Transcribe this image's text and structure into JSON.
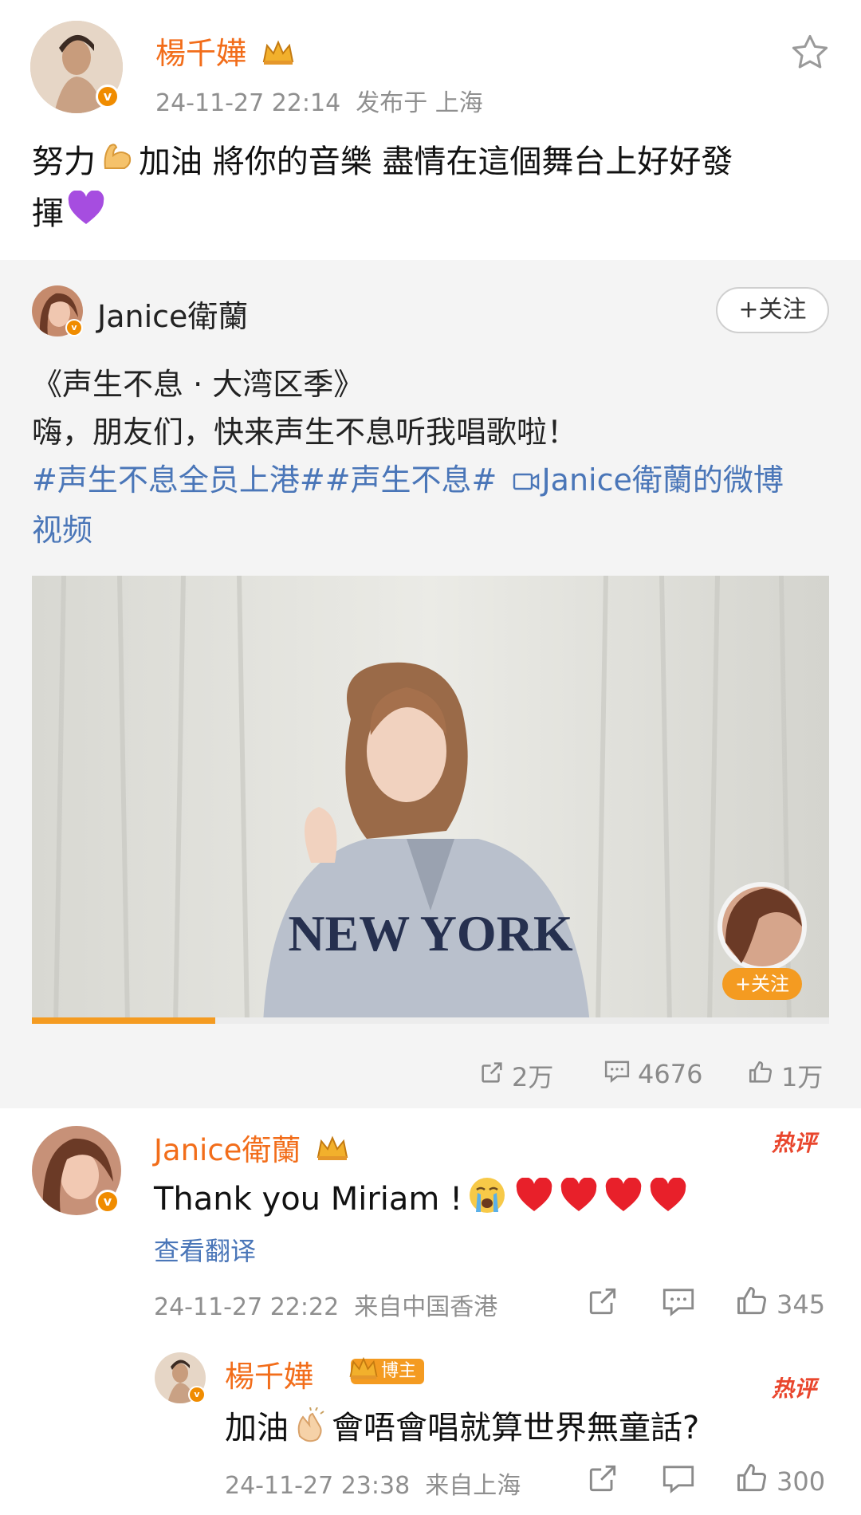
{
  "post": {
    "author": "楊千嬅",
    "time": "24-11-27 22:14",
    "location": "发布于 上海",
    "text_part1": "努力",
    "text_part2": "加油 將你的音樂 盡情在這個舞台上好好發",
    "text_part3": "揮"
  },
  "repost": {
    "author": "Janice衛蘭",
    "follow_label": "+关注",
    "title_line": "《声生不息 · 大湾区季》",
    "text_line": "嗨，朋友们，快来声生不息听我唱歌啦！",
    "hashtag1": "#声生不息全员上港#",
    "hashtag2": "#声生不息#",
    "video_link": "Janice衛蘭的微博",
    "video_link_cont": "视频",
    "video_follow": "+关注",
    "video_shirt_text": "NEW YORK",
    "video_progress": 0.23,
    "stats": {
      "reposts": "2万",
      "comments": "4676",
      "likes": "1万"
    }
  },
  "comments": [
    {
      "author": "Janice衛蘭",
      "hot_label": "热评",
      "text": "Thank you Miriam ! ",
      "translate": "查看翻译",
      "time": "24-11-27 22:22",
      "location": "来自中国香港",
      "likes": "345"
    },
    {
      "author": "楊千嬅",
      "badge": "博主",
      "hot_label": "热评",
      "text_part1": "加油",
      "text_part2": "會唔會唱就算世界無童話?",
      "time": "24-11-27 23:38",
      "location": "来自上海",
      "likes": "300"
    }
  ],
  "colors": {
    "accent_orange": "#f26d1a",
    "hashtag_blue": "#4a76b8",
    "hot_red": "#e9462d",
    "progress": "#f49b21"
  }
}
